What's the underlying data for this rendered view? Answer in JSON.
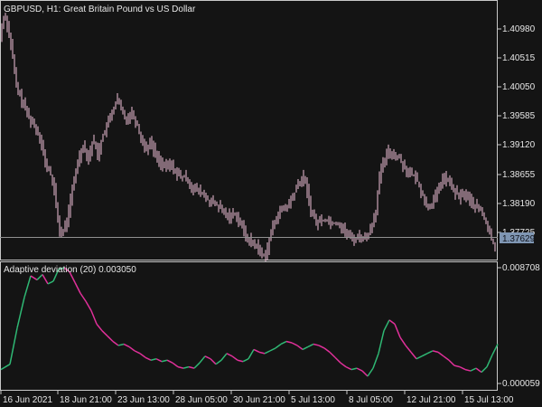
{
  "main": {
    "title": "GBPUSD, H1:  Great Britain Pound vs US Dollar",
    "price_axis_labels": [
      "1.40980",
      "1.40515",
      "1.40050",
      "1.39585",
      "1.39120",
      "1.38655",
      "1.38190",
      "1.37725"
    ],
    "current_price": "1.37629"
  },
  "indicator": {
    "title": "Adaptive deviation (20) 0.003050",
    "axis_labels": [
      "0.008708",
      "0.000059"
    ]
  },
  "time_axis_labels": [
    "16 Jun 2021",
    "18 Jun 21:00",
    "23 Jun 13:00",
    "28 Jun 05:00",
    "30 Jun 21:00",
    "5 Jul 13:00",
    "8 Jul 05:00",
    "12 Jul 21:00",
    "15 Jul 13:00"
  ],
  "colors": {
    "background": "#141414",
    "border": "#c8c8c8",
    "candles": "#f0c0d8",
    "line_up": "#2fb874",
    "line_down": "#e0309a",
    "price_box": "#7f96b3"
  },
  "chart_data": [
    {
      "type": "line",
      "series": [
        {
          "name": "GBPUSD H1",
          "points": [
            [
              0,
              1.4085
            ],
            [
              5,
              1.4125
            ],
            [
              12,
              1.4075
            ],
            [
              18,
              1.401
            ],
            [
              22,
              1.3995
            ],
            [
              28,
              1.3975
            ],
            [
              33,
              1.396
            ],
            [
              38,
              1.395
            ],
            [
              45,
              1.393
            ],
            [
              50,
              1.389
            ],
            [
              55,
              1.388
            ],
            [
              60,
              1.385
            ],
            [
              63,
              1.3815
            ],
            [
              67,
              1.378
            ],
            [
              71,
              1.379
            ],
            [
              75,
              1.381
            ],
            [
              80,
              1.385
            ],
            [
              86,
              1.3895
            ],
            [
              92,
              1.392
            ],
            [
              98,
              1.39
            ],
            [
              103,
              1.393
            ],
            [
              108,
              1.3905
            ],
            [
              114,
              1.3935
            ],
            [
              120,
              1.3955
            ],
            [
              125,
              1.3975
            ],
            [
              130,
              1.399
            ],
            [
              135,
              1.397
            ],
            [
              140,
              1.396
            ],
            [
              146,
              1.397
            ],
            [
              152,
              1.395
            ],
            [
              157,
              1.3925
            ],
            [
              162,
              1.3915
            ],
            [
              167,
              1.3925
            ],
            [
              172,
              1.3905
            ],
            [
              177,
              1.3895
            ],
            [
              182,
              1.3885
            ],
            [
              188,
              1.389
            ],
            [
              194,
              1.388
            ],
            [
              200,
              1.387
            ],
            [
              206,
              1.387
            ],
            [
              212,
              1.3855
            ],
            [
              218,
              1.385
            ],
            [
              224,
              1.3845
            ],
            [
              230,
              1.3835
            ],
            [
              236,
              1.383
            ],
            [
              242,
              1.3825
            ],
            [
              248,
              1.3815
            ],
            [
              254,
              1.381
            ],
            [
              260,
              1.3815
            ],
            [
              266,
              1.38
            ],
            [
              272,
              1.378
            ],
            [
              278,
              1.377
            ],
            [
              284,
              1.3765
            ],
            [
              290,
              1.375
            ],
            [
              295,
              1.3755
            ],
            [
              300,
              1.3785
            ],
            [
              306,
              1.381
            ],
            [
              312,
              1.382
            ],
            [
              318,
              1.3825
            ],
            [
              324,
              1.384
            ],
            [
              330,
              1.386
            ],
            [
              336,
              1.387
            ],
            [
              340,
              1.385
            ],
            [
              344,
              1.382
            ],
            [
              350,
              1.38
            ],
            [
              356,
              1.3805
            ],
            [
              362,
              1.3805
            ],
            [
              368,
              1.38
            ],
            [
              374,
              1.38
            ],
            [
              380,
              1.379
            ],
            [
              386,
              1.378
            ],
            [
              392,
              1.3775
            ],
            [
              398,
              1.378
            ],
            [
              404,
              1.3775
            ],
            [
              410,
              1.379
            ],
            [
              416,
              1.382
            ],
            [
              420,
              1.387
            ],
            [
              424,
              1.389
            ],
            [
              430,
              1.391
            ],
            [
              436,
              1.3905
            ],
            [
              442,
              1.39
            ],
            [
              448,
              1.3885
            ],
            [
              454,
              1.3875
            ],
            [
              460,
              1.387
            ],
            [
              466,
              1.385
            ],
            [
              472,
              1.3825
            ],
            [
              478,
              1.383
            ],
            [
              484,
              1.3845
            ],
            [
              490,
              1.387
            ],
            [
              496,
              1.3865
            ],
            [
              502,
              1.385
            ],
            [
              508,
              1.384
            ],
            [
              514,
              1.3845
            ],
            [
              520,
              1.3835
            ],
            [
              526,
              1.3825
            ],
            [
              532,
              1.382
            ],
            [
              538,
              1.38
            ],
            [
              544,
              1.3775
            ],
            [
              548,
              1.3763
            ]
          ]
        }
      ],
      "ylim": [
        1.3745,
        1.414
      ]
    },
    {
      "type": "line",
      "series": [
        {
          "name": "Adaptive deviation (20)",
          "points": [
            [
              0,
              0.0011
            ],
            [
              10,
              0.0015
            ],
            [
              18,
              0.0042
            ],
            [
              26,
              0.0065
            ],
            [
              33,
              0.0081
            ],
            [
              40,
              0.0078
            ],
            [
              46,
              0.0082
            ],
            [
              52,
              0.0075
            ],
            [
              58,
              0.0077
            ],
            [
              64,
              0.0086
            ],
            [
              70,
              0.0087
            ],
            [
              76,
              0.0084
            ],
            [
              82,
              0.0076
            ],
            [
              88,
              0.0068
            ],
            [
              94,
              0.0062
            ],
            [
              100,
              0.0055
            ],
            [
              106,
              0.0045
            ],
            [
              112,
              0.004
            ],
            [
              118,
              0.0036
            ],
            [
              124,
              0.0032
            ],
            [
              130,
              0.0029
            ],
            [
              136,
              0.003
            ],
            [
              142,
              0.0028
            ],
            [
              148,
              0.0025
            ],
            [
              154,
              0.0023
            ],
            [
              160,
              0.002
            ],
            [
              166,
              0.0018
            ],
            [
              172,
              0.0019
            ],
            [
              178,
              0.0017
            ],
            [
              184,
              0.0018
            ],
            [
              190,
              0.0016
            ],
            [
              196,
              0.0013
            ],
            [
              202,
              0.0012
            ],
            [
              208,
              0.0013
            ],
            [
              214,
              0.0012
            ],
            [
              220,
              0.0016
            ],
            [
              226,
              0.0021
            ],
            [
              232,
              0.0019
            ],
            [
              238,
              0.0015
            ],
            [
              244,
              0.0018
            ],
            [
              250,
              0.0023
            ],
            [
              256,
              0.0021
            ],
            [
              262,
              0.0018
            ],
            [
              268,
              0.0017
            ],
            [
              274,
              0.0019
            ],
            [
              280,
              0.0026
            ],
            [
              286,
              0.0024
            ],
            [
              292,
              0.0023
            ],
            [
              298,
              0.0025
            ],
            [
              304,
              0.0027
            ],
            [
              310,
              0.003
            ],
            [
              316,
              0.0032
            ],
            [
              322,
              0.0031
            ],
            [
              328,
              0.0029
            ],
            [
              334,
              0.0026
            ],
            [
              340,
              0.0028
            ],
            [
              346,
              0.003
            ],
            [
              352,
              0.0029
            ],
            [
              358,
              0.0027
            ],
            [
              364,
              0.0024
            ],
            [
              370,
              0.002
            ],
            [
              376,
              0.0016
            ],
            [
              382,
              0.0013
            ],
            [
              388,
              0.0011
            ],
            [
              394,
              0.0012
            ],
            [
              400,
              0.001
            ],
            [
              406,
              0.0006
            ],
            [
              412,
              0.0012
            ],
            [
              418,
              0.0023
            ],
            [
              424,
              0.004
            ],
            [
              430,
              0.0048
            ],
            [
              436,
              0.0045
            ],
            [
              442,
              0.0035
            ],
            [
              448,
              0.0029
            ],
            [
              454,
              0.0024
            ],
            [
              460,
              0.0019
            ],
            [
              466,
              0.0021
            ],
            [
              472,
              0.0023
            ],
            [
              478,
              0.0025
            ],
            [
              484,
              0.0024
            ],
            [
              490,
              0.0021
            ],
            [
              496,
              0.0018
            ],
            [
              502,
              0.0014
            ],
            [
              508,
              0.0013
            ],
            [
              514,
              0.0011
            ],
            [
              520,
              0.001
            ],
            [
              526,
              0.0012
            ],
            [
              532,
              0.0009
            ],
            [
              538,
              0.0013
            ],
            [
              544,
              0.0022
            ],
            [
              550,
              0.003
            ]
          ]
        }
      ],
      "ylim": [
        5.9e-05,
        0.008708
      ]
    }
  ]
}
